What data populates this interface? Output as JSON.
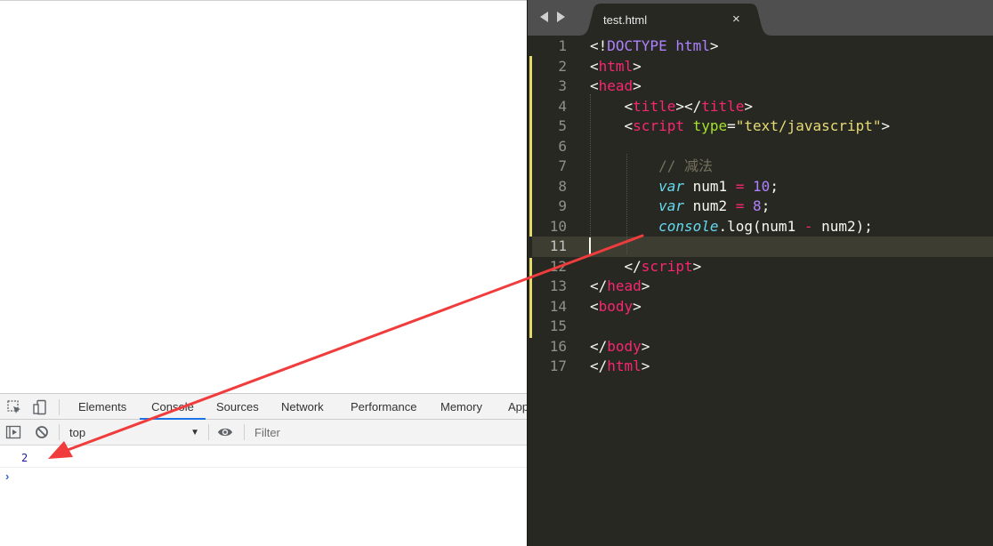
{
  "devtools": {
    "tabs": [
      {
        "label": "Elements"
      },
      {
        "label": "Console",
        "active": true
      },
      {
        "label": "Sources"
      },
      {
        "label": "Network"
      },
      {
        "label": "Performance"
      },
      {
        "label": "Memory"
      },
      {
        "label": "App"
      }
    ],
    "toolbar": {
      "context": "top",
      "filter_placeholder": "Filter"
    },
    "console": {
      "output": "2",
      "prompt": "›"
    }
  },
  "editor": {
    "tab_label": "test.html",
    "close_glyph": "×",
    "current_line": 11,
    "lines": [
      {
        "n": "1",
        "tokens": [
          [
            "p",
            "<!"
          ],
          [
            "dt",
            "DOCTYPE"
          ],
          [
            "p",
            " "
          ],
          [
            "dt",
            "html"
          ],
          [
            "p",
            ">"
          ]
        ]
      },
      {
        "n": "2",
        "tokens": [
          [
            "p",
            "<"
          ],
          [
            "tag",
            "html"
          ],
          [
            "p",
            ">"
          ]
        ]
      },
      {
        "n": "3",
        "tokens": [
          [
            "p",
            "<"
          ],
          [
            "tag",
            "head"
          ],
          [
            "p",
            ">"
          ]
        ]
      },
      {
        "n": "4",
        "tokens": [
          [
            "p",
            "    <"
          ],
          [
            "tag",
            "title"
          ],
          [
            "p",
            "></"
          ],
          [
            "tag",
            "title"
          ],
          [
            "p",
            ">"
          ]
        ]
      },
      {
        "n": "5",
        "tokens": [
          [
            "p",
            "    <"
          ],
          [
            "tag",
            "script"
          ],
          [
            "p",
            " "
          ],
          [
            "attr",
            "type"
          ],
          [
            "p",
            "="
          ],
          [
            "str",
            "\"text/javascript\""
          ],
          [
            "p",
            ">"
          ]
        ]
      },
      {
        "n": "6",
        "tokens": []
      },
      {
        "n": "7",
        "tokens": [
          [
            "p",
            "        "
          ],
          [
            "cm",
            "// 减法"
          ]
        ]
      },
      {
        "n": "8",
        "tokens": [
          [
            "p",
            "        "
          ],
          [
            "kw",
            "var"
          ],
          [
            "p",
            " num1 "
          ],
          [
            "op",
            "="
          ],
          [
            "p",
            " "
          ],
          [
            "num",
            "10"
          ],
          [
            "p",
            ";"
          ]
        ]
      },
      {
        "n": "9",
        "tokens": [
          [
            "p",
            "        "
          ],
          [
            "kw",
            "var"
          ],
          [
            "p",
            " num2 "
          ],
          [
            "op",
            "="
          ],
          [
            "p",
            " "
          ],
          [
            "num",
            "8"
          ],
          [
            "p",
            ";"
          ]
        ]
      },
      {
        "n": "10",
        "tokens": [
          [
            "p",
            "        "
          ],
          [
            "kw",
            "console"
          ],
          [
            "p",
            ".log(num1 "
          ],
          [
            "op",
            "-"
          ],
          [
            "p",
            " num2);"
          ]
        ]
      },
      {
        "n": "11",
        "tokens": []
      },
      {
        "n": "12",
        "tokens": [
          [
            "p",
            "    </"
          ],
          [
            "tag",
            "script"
          ],
          [
            "p",
            ">"
          ]
        ]
      },
      {
        "n": "13",
        "tokens": [
          [
            "p",
            "</"
          ],
          [
            "tag",
            "head"
          ],
          [
            "p",
            ">"
          ]
        ]
      },
      {
        "n": "14",
        "tokens": [
          [
            "p",
            "<"
          ],
          [
            "tag",
            "body"
          ],
          [
            "p",
            ">"
          ]
        ]
      },
      {
        "n": "15",
        "tokens": []
      },
      {
        "n": "16",
        "tokens": [
          [
            "p",
            "</"
          ],
          [
            "tag",
            "body"
          ],
          [
            "p",
            ">"
          ]
        ]
      },
      {
        "n": "17",
        "tokens": [
          [
            "p",
            "</"
          ],
          [
            "tag",
            "html"
          ],
          [
            "p",
            ">"
          ]
        ]
      }
    ]
  },
  "colors": {
    "editor_bg": "#272822",
    "annotation_arrow": "#f03c3c",
    "console_value": "#1a1aa6",
    "active_tab_underline": "#1a73e8"
  },
  "icons": [
    "inspect-element-icon",
    "device-toggle-icon",
    "execute-context-icon",
    "clear-console-icon",
    "eye-icon",
    "nav-back-icon",
    "nav-forward-icon",
    "close-icon"
  ]
}
